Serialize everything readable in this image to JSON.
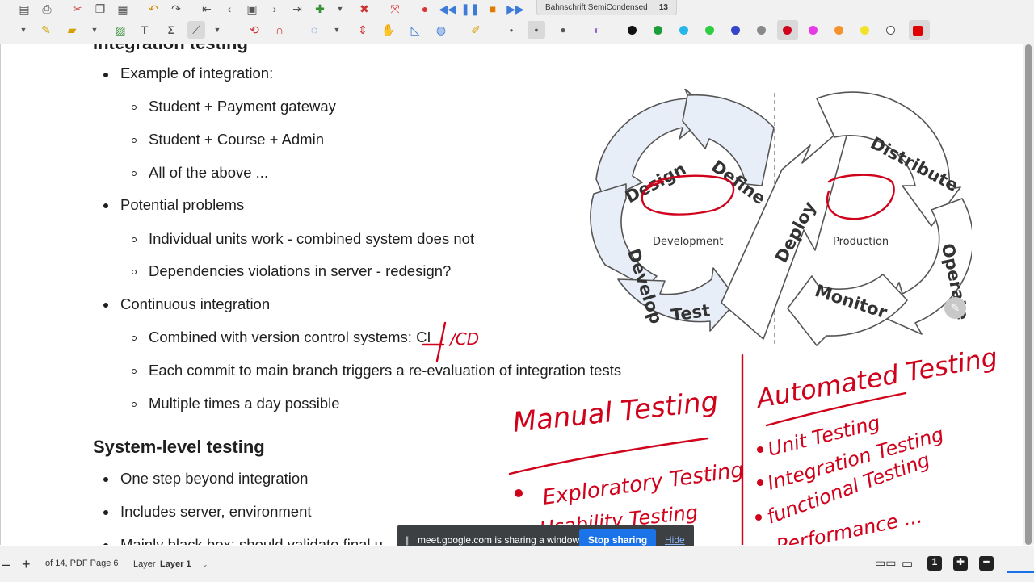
{
  "toolbar": {
    "font_name": "Bahnschrift SemiCondensed",
    "font_size": "13",
    "palette": [
      "#111111",
      "#1e9e3a",
      "#27b6e8",
      "#2ecc40",
      "#3545c8",
      "#8a8a8a",
      "#d0021b",
      "#e63ae6",
      "#f5922b",
      "#f2e22a",
      "#ffffff",
      "#e00000"
    ]
  },
  "doc": {
    "heading_partial": "Integration testing",
    "items": [
      {
        "level": 1,
        "text": "Example of integration:"
      },
      {
        "level": 2,
        "text": "Student + Payment gateway"
      },
      {
        "level": 2,
        "text": "Student + Course + Admin"
      },
      {
        "level": 2,
        "text": "All of the above ..."
      },
      {
        "level": 1,
        "text": "Potential problems"
      },
      {
        "level": 2,
        "text": "Individual units work - combined system does not"
      },
      {
        "level": 2,
        "text": "Dependencies violations in server - redesign?"
      },
      {
        "level": 1,
        "text": "Continuous integration"
      },
      {
        "level": 2,
        "text": "Combined with version control systems: CI"
      },
      {
        "level": 2,
        "text": "Each commit to main branch triggers a re-evaluation of integration tests"
      },
      {
        "level": 2,
        "text": "Multiple times a day possible"
      }
    ],
    "section2_title": "System-level testing",
    "section2_items": [
      "One step beyond integration",
      "Includes server, environment",
      "Mainly black box; should validate final u"
    ]
  },
  "diagram": {
    "labels": [
      "Design",
      "Define",
      "Develop",
      "Test",
      "Deploy",
      "Distribute",
      "Operate",
      "Monitor"
    ],
    "center_left": "Development",
    "center_right": "Production"
  },
  "ink": {
    "ci_annotation": "/CD",
    "manual_title": "Manual Testing",
    "manual_items": [
      "Exploratory Testing",
      "Usability Testing"
    ],
    "auto_title": "Automated Testing",
    "auto_items": [
      "Unit Testing",
      "Integration Testing",
      "functional Testing",
      "Performance ..."
    ]
  },
  "share_bar": {
    "message": "meet.google.com is sharing a window.",
    "stop_label": "Stop sharing",
    "hide_label": "Hide"
  },
  "status": {
    "page_info": "of 14, PDF Page 6",
    "layer_label": "Layer",
    "layer_value": "Layer 1"
  }
}
